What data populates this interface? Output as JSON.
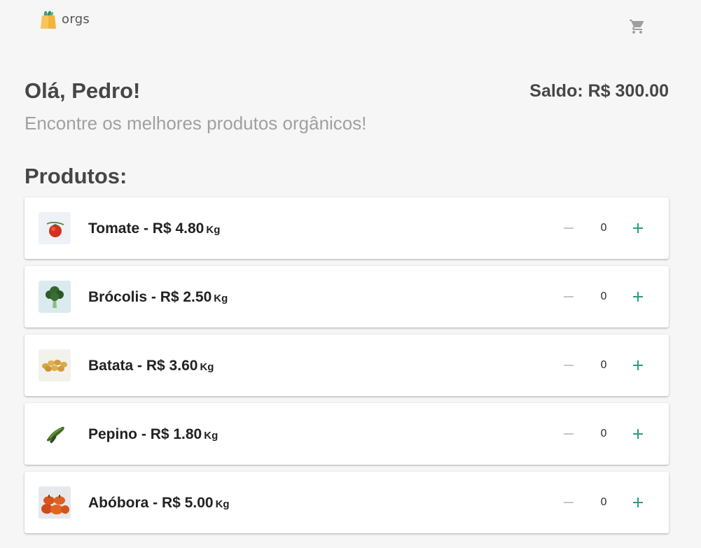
{
  "header": {
    "logo_text": "orgs",
    "logo_icon": "shopping-bag-icon",
    "cart_icon": "cart-icon"
  },
  "greeting": "Olá, Pedro!",
  "balance": "Saldo: R$ 300.00",
  "subtitle": "Encontre os melhores produtos orgânicos!",
  "section_title": "Produtos:",
  "products": [
    {
      "name": "Tomate",
      "price": "R$ 4.80",
      "unit": "Kg",
      "quantity": "0",
      "image": "tomato-image"
    },
    {
      "name": "Brócolis",
      "price": "R$ 2.50",
      "unit": "Kg",
      "quantity": "0",
      "image": "broccoli-image"
    },
    {
      "name": "Batata",
      "price": "R$ 3.60",
      "unit": "Kg",
      "quantity": "0",
      "image": "potato-image"
    },
    {
      "name": "Pepino",
      "price": "R$ 1.80",
      "unit": "Kg",
      "quantity": "0",
      "image": "cucumber-image"
    },
    {
      "name": "Abóbora",
      "price": "R$ 5.00",
      "unit": "Kg",
      "quantity": "0",
      "image": "pumpkin-image"
    }
  ],
  "colors": {
    "background": "#f6f6f6",
    "text_dark": "#464646",
    "text_muted": "#a0a0a0",
    "minus_disabled": "#c6c6c6",
    "plus_accent": "#2a9d7f"
  }
}
